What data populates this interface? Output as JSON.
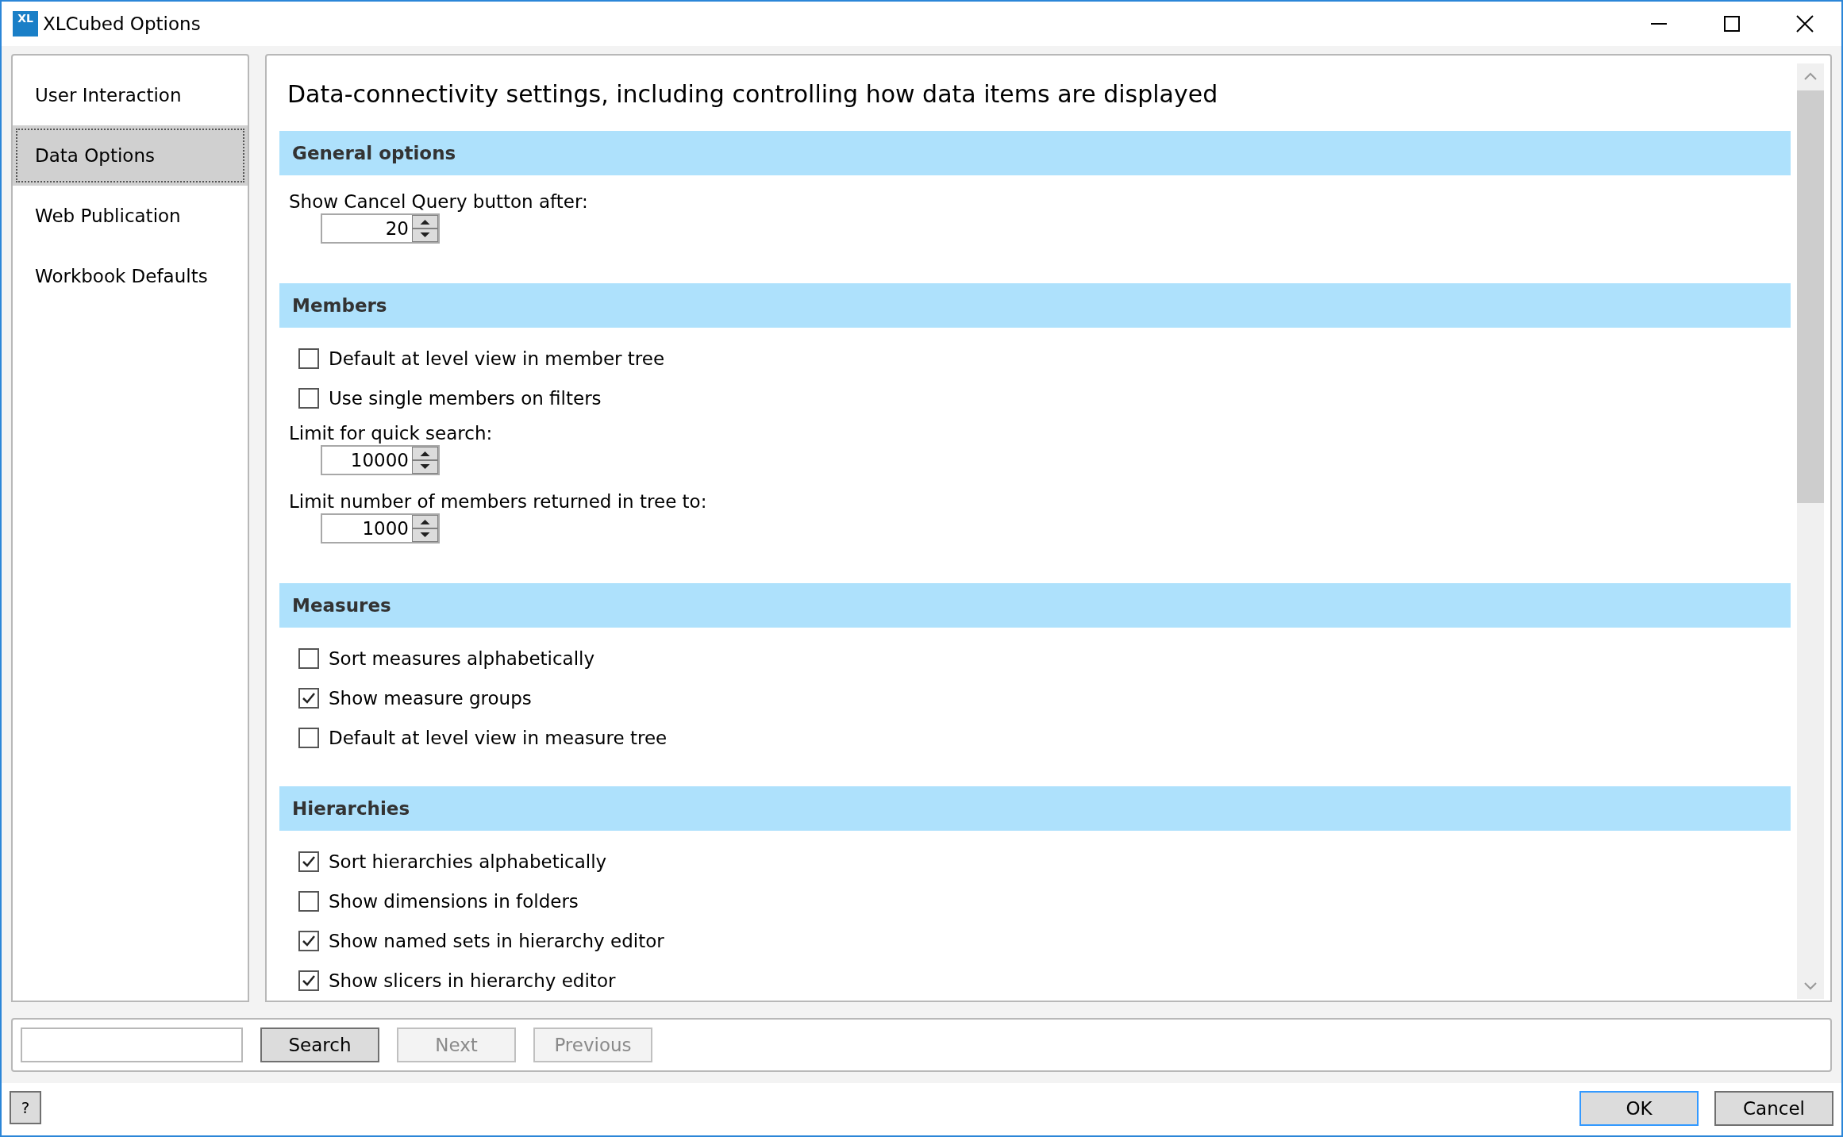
{
  "window": {
    "title": "XLCubed Options",
    "logo": "XL"
  },
  "sidebar": {
    "items": [
      {
        "label": "User Interaction",
        "selected": false
      },
      {
        "label": "Data Options",
        "selected": true
      },
      {
        "label": "Web Publication",
        "selected": false
      },
      {
        "label": "Workbook Defaults",
        "selected": false
      }
    ]
  },
  "content": {
    "description": "Data-connectivity settings, including controlling how data items are displayed",
    "sections": [
      {
        "title": "General options",
        "items": [
          {
            "kind": "spinner",
            "label": "Show Cancel Query button after:",
            "value": "20"
          }
        ]
      },
      {
        "title": "Members",
        "items": [
          {
            "kind": "checkbox",
            "label": "Default at level view in member tree",
            "checked": false
          },
          {
            "kind": "checkbox",
            "label": "Use single members on filters",
            "checked": false
          },
          {
            "kind": "spinner",
            "label": "Limit for quick search:",
            "value": "10000"
          },
          {
            "kind": "spinner",
            "label": "Limit number of members returned in tree to:",
            "value": "1000"
          }
        ]
      },
      {
        "title": "Measures",
        "items": [
          {
            "kind": "checkbox",
            "label": "Sort measures alphabetically",
            "checked": false
          },
          {
            "kind": "checkbox",
            "label": "Show measure groups",
            "checked": true
          },
          {
            "kind": "checkbox",
            "label": "Default at level view in measure tree",
            "checked": false
          }
        ]
      },
      {
        "title": "Hierarchies",
        "items": [
          {
            "kind": "checkbox",
            "label": "Sort hierarchies alphabetically",
            "checked": true
          },
          {
            "kind": "checkbox",
            "label": "Show dimensions in folders",
            "checked": false
          },
          {
            "kind": "checkbox",
            "label": "Show named sets in hierarchy editor",
            "checked": true
          },
          {
            "kind": "checkbox",
            "label": "Show slicers in hierarchy editor",
            "checked": true
          }
        ]
      }
    ]
  },
  "search_bar": {
    "buttons": [
      {
        "label": "Search",
        "disabled": false
      },
      {
        "label": "Next",
        "disabled": true
      },
      {
        "label": "Previous",
        "disabled": true
      }
    ]
  },
  "footer": {
    "help": "?",
    "buttons": [
      {
        "label": "OK",
        "default": true
      },
      {
        "label": "Cancel",
        "default": false
      }
    ]
  }
}
